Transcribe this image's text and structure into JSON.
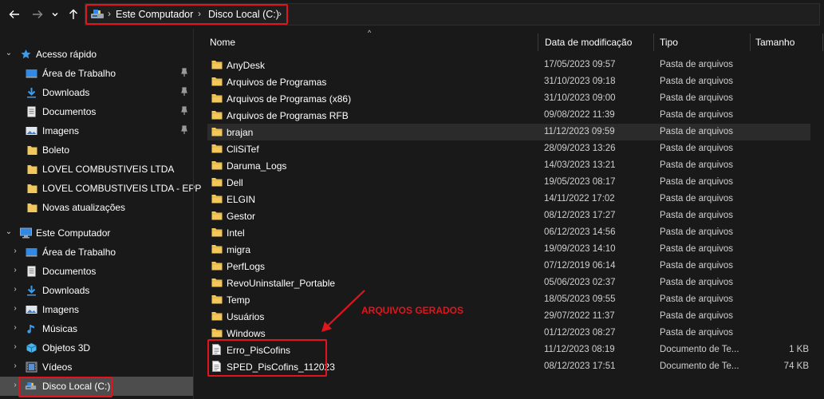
{
  "nav": {
    "back_icon": "arrow-left-icon",
    "forward_icon": "arrow-right-icon",
    "recent_icon": "chevron-down-icon",
    "up_icon": "arrow-up-icon"
  },
  "address": {
    "icon": "drive-icon",
    "crumbs": [
      "Este Computador",
      "Disco Local (C:)"
    ]
  },
  "sidebar": {
    "quick_access": {
      "label": "Acesso rápido",
      "items": [
        {
          "label": "Área de Trabalho",
          "icon": "desktop-icon",
          "pinned": true
        },
        {
          "label": "Downloads",
          "icon": "download-icon",
          "pinned": true
        },
        {
          "label": "Documentos",
          "icon": "document-icon",
          "pinned": true
        },
        {
          "label": "Imagens",
          "icon": "image-icon",
          "pinned": true
        },
        {
          "label": "Boleto",
          "icon": "folder-icon",
          "pinned": false
        },
        {
          "label": "LOVEL COMBUSTIVEIS LTDA",
          "icon": "folder-icon",
          "pinned": false
        },
        {
          "label": "LOVEL COMBUSTIVEIS LTDA - EPP",
          "icon": "folder-icon",
          "pinned": false
        },
        {
          "label": "Novas atualizações",
          "icon": "folder-icon",
          "pinned": false
        }
      ]
    },
    "this_pc": {
      "label": "Este Computador",
      "items": [
        {
          "label": "Área de Trabalho",
          "icon": "desktop-icon"
        },
        {
          "label": "Documentos",
          "icon": "document-icon"
        },
        {
          "label": "Downloads",
          "icon": "download-icon"
        },
        {
          "label": "Imagens",
          "icon": "image-icon"
        },
        {
          "label": "Músicas",
          "icon": "music-icon"
        },
        {
          "label": "Objetos 3D",
          "icon": "cube-icon"
        },
        {
          "label": "Vídeos",
          "icon": "video-icon"
        },
        {
          "label": "Disco Local (C:)",
          "icon": "drive-icon",
          "selected": true
        }
      ]
    }
  },
  "columns": {
    "name": "Nome",
    "date": "Data de modificação",
    "type": "Tipo",
    "size": "Tamanho"
  },
  "rows": [
    {
      "name": "AnyDesk",
      "date": "17/05/2023 09:57",
      "type": "Pasta de arquivos",
      "size": "",
      "kind": "folder"
    },
    {
      "name": "Arquivos de Programas",
      "date": "31/10/2023 09:18",
      "type": "Pasta de arquivos",
      "size": "",
      "kind": "folder"
    },
    {
      "name": "Arquivos de Programas (x86)",
      "date": "31/10/2023 09:00",
      "type": "Pasta de arquivos",
      "size": "",
      "kind": "folder"
    },
    {
      "name": "Arquivos de Programas RFB",
      "date": "09/08/2022 11:39",
      "type": "Pasta de arquivos",
      "size": "",
      "kind": "folder"
    },
    {
      "name": "brajan",
      "date": "11/12/2023 09:59",
      "type": "Pasta de arquivos",
      "size": "",
      "kind": "folder",
      "hover": true
    },
    {
      "name": "CliSiTef",
      "date": "28/09/2023 13:26",
      "type": "Pasta de arquivos",
      "size": "",
      "kind": "folder"
    },
    {
      "name": "Daruma_Logs",
      "date": "14/03/2023 13:21",
      "type": "Pasta de arquivos",
      "size": "",
      "kind": "folder"
    },
    {
      "name": "Dell",
      "date": "19/05/2023 08:17",
      "type": "Pasta de arquivos",
      "size": "",
      "kind": "folder"
    },
    {
      "name": "ELGIN",
      "date": "14/11/2022 17:02",
      "type": "Pasta de arquivos",
      "size": "",
      "kind": "folder"
    },
    {
      "name": "Gestor",
      "date": "08/12/2023 17:27",
      "type": "Pasta de arquivos",
      "size": "",
      "kind": "folder"
    },
    {
      "name": "Intel",
      "date": "06/12/2023 14:56",
      "type": "Pasta de arquivos",
      "size": "",
      "kind": "folder"
    },
    {
      "name": "migra",
      "date": "19/09/2023 14:10",
      "type": "Pasta de arquivos",
      "size": "",
      "kind": "folder"
    },
    {
      "name": "PerfLogs",
      "date": "07/12/2019 06:14",
      "type": "Pasta de arquivos",
      "size": "",
      "kind": "folder"
    },
    {
      "name": "RevoUninstaller_Portable",
      "date": "05/06/2023 02:37",
      "type": "Pasta de arquivos",
      "size": "",
      "kind": "folder"
    },
    {
      "name": "Temp",
      "date": "18/05/2023 09:55",
      "type": "Pasta de arquivos",
      "size": "",
      "kind": "folder"
    },
    {
      "name": "Usuários",
      "date": "29/07/2022 11:37",
      "type": "Pasta de arquivos",
      "size": "",
      "kind": "folder"
    },
    {
      "name": "Windows",
      "date": "01/12/2023 08:27",
      "type": "Pasta de arquivos",
      "size": "",
      "kind": "folder"
    },
    {
      "name": "Erro_PisCofins",
      "date": "11/12/2023 08:19",
      "type": "Documento de Te...",
      "size": "1 KB",
      "kind": "file"
    },
    {
      "name": "SPED_PisCofins_112023",
      "date": "08/12/2023 17:51",
      "type": "Documento de Te...",
      "size": "74 KB",
      "kind": "file"
    }
  ],
  "annotation": {
    "text": "ARQUIVOS GERADOS"
  },
  "colors": {
    "background": "#191919",
    "highlight": "#e0161e",
    "folder": "#f2c85b",
    "selected": "#4d4d4d",
    "hover": "#2b2b2b"
  }
}
